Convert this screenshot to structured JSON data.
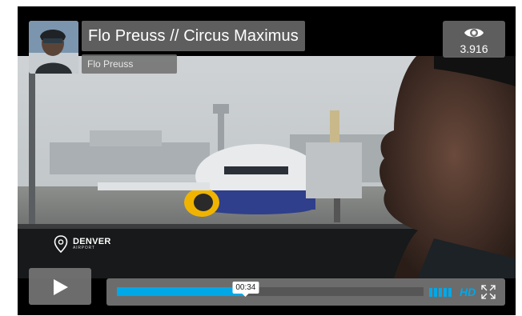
{
  "video": {
    "title": "Flo Preuss // Circus Maximus",
    "author": "Flo Preuss",
    "views": "3.916",
    "location": {
      "name": "DENVER",
      "sub": "AIRPORT"
    }
  },
  "controls": {
    "current_time": "00:34",
    "progress": 0.42,
    "volume_bars": 5,
    "hd_label": "HD"
  },
  "colors": {
    "accent": "#00a8e8",
    "overlay": "#6e6e6e"
  },
  "icons": [
    "eye-icon",
    "play-icon",
    "fullscreen-icon",
    "location-pin-icon",
    "volume-icon"
  ]
}
